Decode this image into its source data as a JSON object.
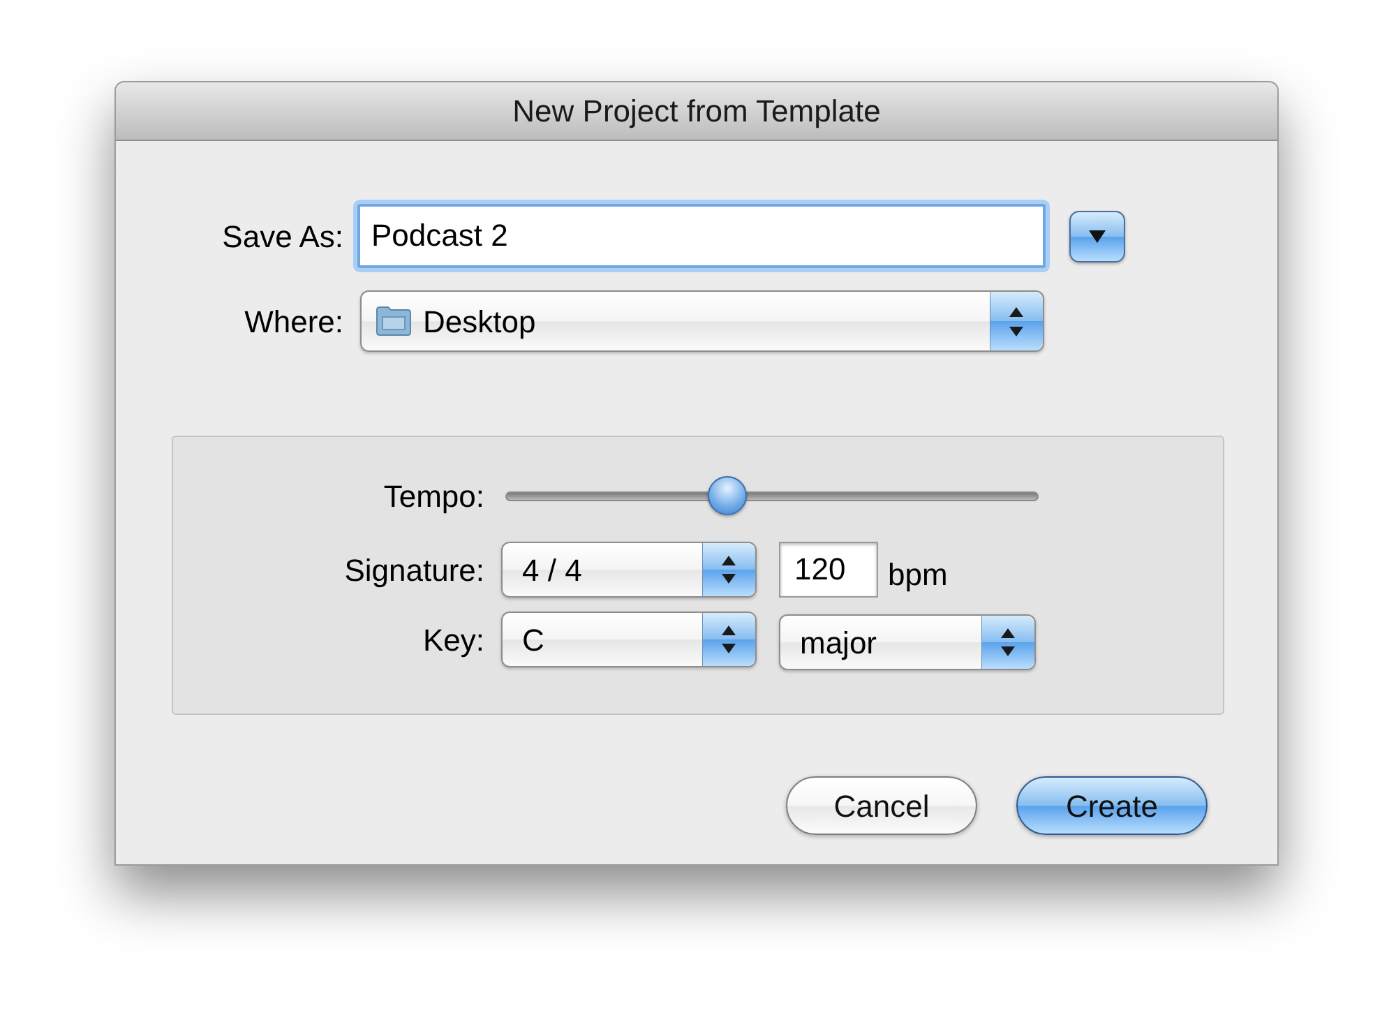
{
  "window": {
    "title": "New Project from Template"
  },
  "save_as": {
    "label": "Save As:",
    "value": "Podcast 2",
    "focused": true
  },
  "where": {
    "label": "Where:",
    "value": "Desktop"
  },
  "tempo": {
    "label": "Tempo:",
    "level": 0.41
  },
  "signature": {
    "label": "Signature:",
    "value": "4 / 4"
  },
  "bpm": {
    "value": "120",
    "unit": "bpm"
  },
  "key": {
    "label": "Key:",
    "value": "C",
    "mode": "major"
  },
  "buttons": [
    {
      "label": "Cancel",
      "default": false
    },
    {
      "label": "Create",
      "default": true
    }
  ]
}
